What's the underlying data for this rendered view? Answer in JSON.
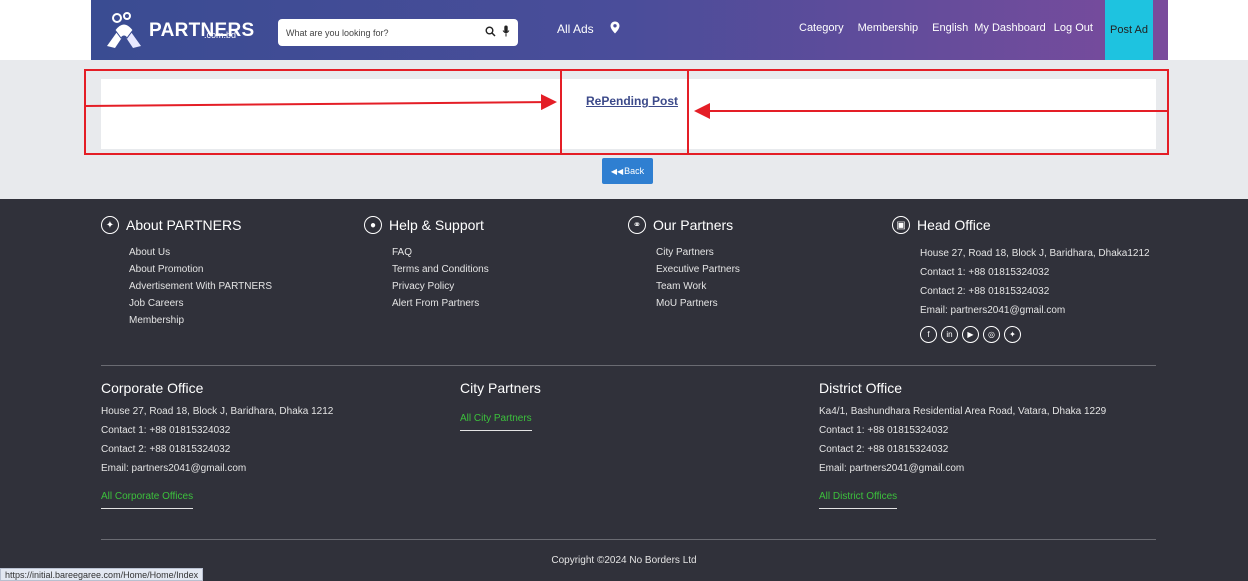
{
  "header": {
    "logo_text": "PARTNERS",
    "logo_sub": ".com.bd",
    "search_placeholder": "What are you looking for?",
    "all_ads": "All Ads",
    "nav": [
      "Category",
      "Membership",
      "English",
      "My Dashboard",
      "Log Out"
    ],
    "post_ad": "Post Ad"
  },
  "main": {
    "title": "RePending Post",
    "back_label": "Back"
  },
  "footer": {
    "about": {
      "title": "About PARTNERS",
      "items": [
        "About Us",
        "About Promotion",
        "Advertisement With PARTNERS",
        "Job Careers",
        "Membership"
      ]
    },
    "help": {
      "title": "Help & Support",
      "items": [
        "FAQ",
        "Terms and Conditions",
        "Privacy Policy",
        "Alert From Partners"
      ]
    },
    "partners": {
      "title": "Our Partners",
      "items": [
        "City Partners",
        "Executive Partners",
        "Team Work",
        "MoU Partners"
      ]
    },
    "head_office": {
      "title": "Head Office",
      "lines": [
        "House 27, Road 18, Block J, Baridhara, Dhaka1212",
        "Contact 1: +88 01815324032",
        "Contact 2: +88 01815324032",
        "Email: partners2041@gmail.com"
      ]
    },
    "corporate": {
      "title": "Corporate Office",
      "lines": [
        "House 27, Road 18, Block J, Baridhara, Dhaka 1212",
        "Contact 1: +88 01815324032",
        "Contact 2: +88 01815324032",
        "Email: partners2041@gmail.com"
      ],
      "link": "All Corporate Offices"
    },
    "city": {
      "title": "City Partners",
      "link": "All City Partners"
    },
    "district": {
      "title": "District Office",
      "lines": [
        "Ka4/1, Bashundhara Residential Area Road, Vatara, Dhaka 1229",
        "Contact 1: +88 01815324032",
        "Contact 2: +88 01815324032",
        "Email: partners2041@gmail.com"
      ],
      "link": "All District Offices"
    },
    "copyright": "Copyright ©2024 No Borders Ltd"
  },
  "status_url": "https://initial.bareegaree.com/Home/Home/Index",
  "colors": {
    "accent": "#1ec3e0",
    "button": "#2f7fd1",
    "annotation": "#e41e26",
    "link_green": "#3cc13c"
  }
}
